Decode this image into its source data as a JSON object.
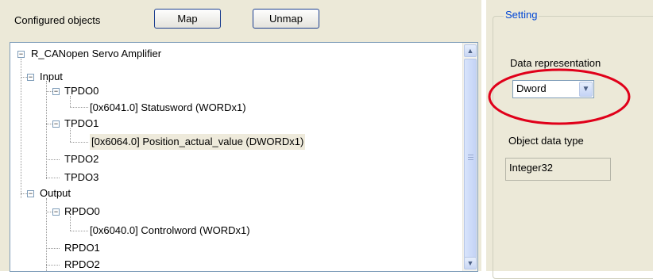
{
  "toolbar": {
    "label": "Configured objects",
    "map_label": "Map",
    "unmap_label": "Unmap"
  },
  "tree": {
    "root": "R_CANopen Servo Amplifier",
    "input": "Input",
    "tpdo0": "TPDO0",
    "statusword": "[0x6041.0] Statusword  (WORDx1)",
    "tpdo1": "TPDO1",
    "position": "[0x6064.0] Position_actual_value  (DWORDx1)",
    "tpdo2": "TPDO2",
    "tpdo3": "TPDO3",
    "output": "Output",
    "rpdo0": "RPDO0",
    "controlword": "[0x6040.0] Controlword  (WORDx1)",
    "rpdo1": "RPDO1",
    "rpdo2": "RPDO2"
  },
  "setting": {
    "title": "Setting",
    "data_rep_label": "Data representation",
    "data_rep_value": "Dword",
    "object_type_label": "Object data type",
    "object_type_value": "Integer32"
  },
  "colors": {
    "highlight": "#e0001a",
    "selection": "#eeeadb",
    "group_title": "#0046d5"
  },
  "icons": {
    "collapse": "minus-box",
    "scroll_up": "triangle-up",
    "scroll_down": "triangle-down",
    "dropdown": "chevron-down"
  }
}
